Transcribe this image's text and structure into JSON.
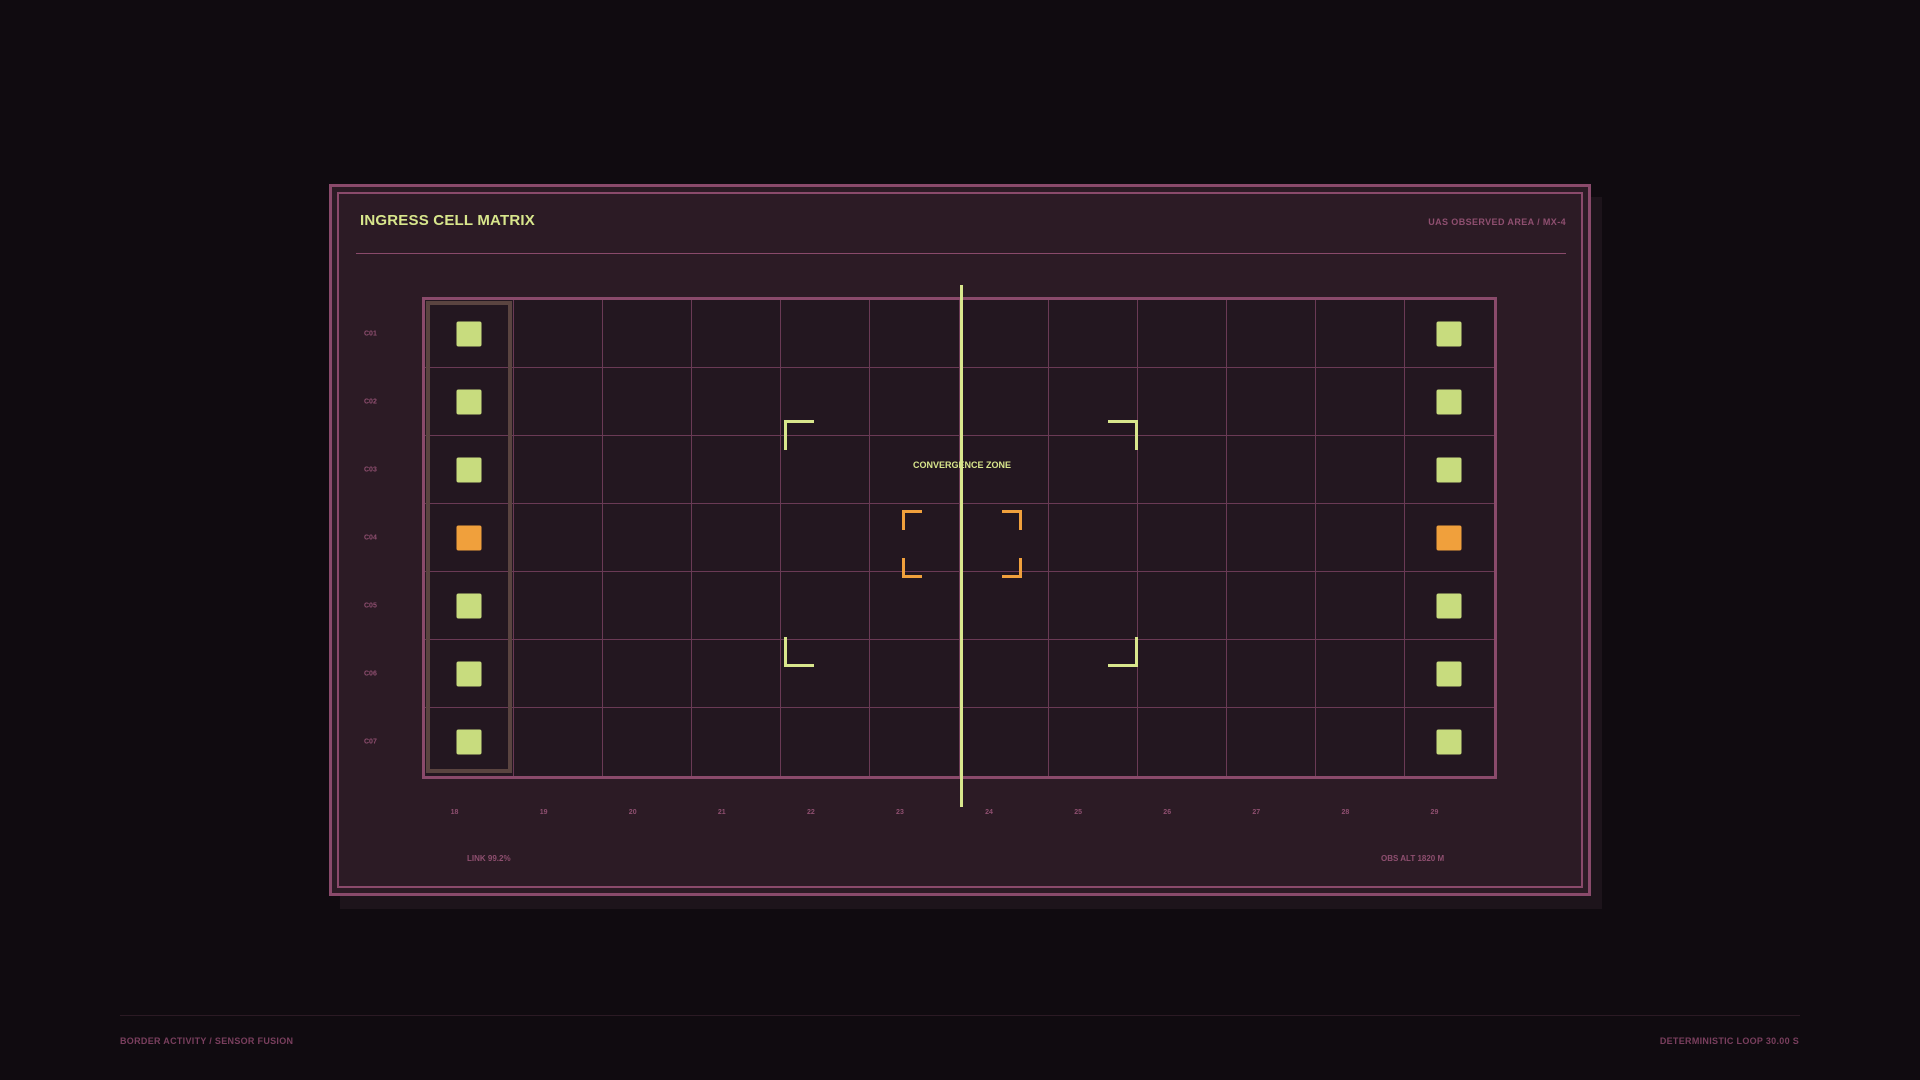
{
  "panel": {
    "title": "INGRESS CELL MATRIX",
    "subtitle": "UAS OBSERVED AREA / MX-4",
    "link_status": "LINK 99.2%",
    "obs_alt": "OBS ALT 1820 M"
  },
  "zone": {
    "label": "CONVERGENCE ZONE"
  },
  "matrix": {
    "rows": [
      "C01",
      "C02",
      "C03",
      "C04",
      "C05",
      "C06",
      "C07"
    ],
    "columns": [
      "18",
      "19",
      "20",
      "21",
      "22",
      "23",
      "24",
      "25",
      "26",
      "27",
      "28",
      "29"
    ],
    "highlighted_column": "18",
    "markers": [
      {
        "row": 0,
        "col": 0,
        "state": "nominal"
      },
      {
        "row": 1,
        "col": 0,
        "state": "nominal"
      },
      {
        "row": 2,
        "col": 0,
        "state": "nominal"
      },
      {
        "row": 3,
        "col": 0,
        "state": "alert"
      },
      {
        "row": 4,
        "col": 0,
        "state": "nominal"
      },
      {
        "row": 5,
        "col": 0,
        "state": "nominal"
      },
      {
        "row": 6,
        "col": 0,
        "state": "nominal"
      },
      {
        "row": 0,
        "col": 11,
        "state": "nominal"
      },
      {
        "row": 1,
        "col": 11,
        "state": "nominal"
      },
      {
        "row": 2,
        "col": 11,
        "state": "nominal"
      },
      {
        "row": 3,
        "col": 11,
        "state": "alert"
      },
      {
        "row": 4,
        "col": 11,
        "state": "nominal"
      },
      {
        "row": 5,
        "col": 11,
        "state": "nominal"
      },
      {
        "row": 6,
        "col": 11,
        "state": "nominal"
      }
    ]
  },
  "footer": {
    "left": "BORDER ACTIVITY / SENSOR FUSION",
    "right": "DETERMINISTIC LOOP 30.00 S"
  },
  "colors": {
    "background": "#100b10",
    "panel": "#2c1b25",
    "frame": "#8a4a6b",
    "nominal": "#c8dc7e",
    "alert": "#f0a03c",
    "accent": "#d8e68c"
  }
}
